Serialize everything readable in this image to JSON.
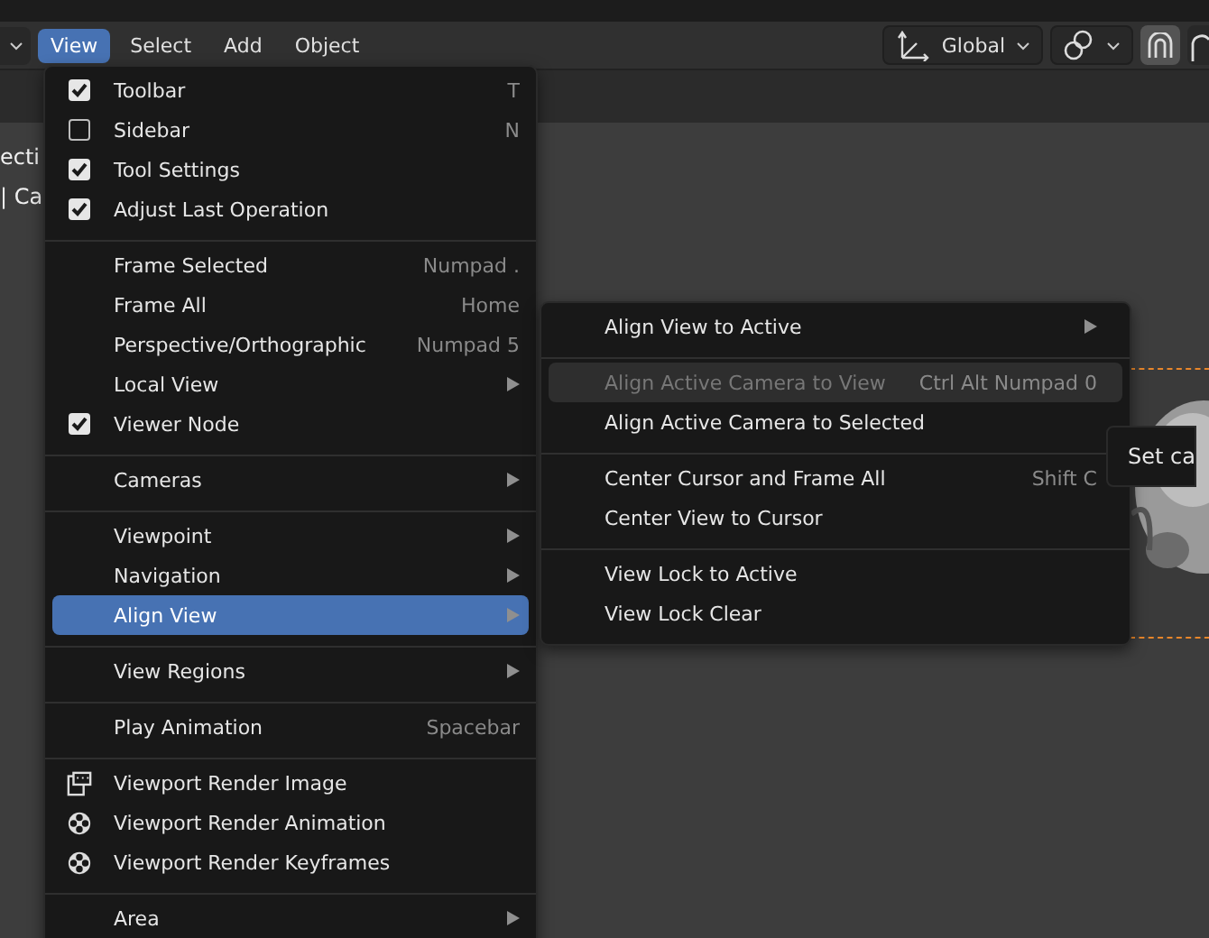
{
  "header": {
    "menus": [
      {
        "label": "View",
        "selected": true
      },
      {
        "label": "Select",
        "selected": false
      },
      {
        "label": "Add",
        "selected": false
      },
      {
        "label": "Object",
        "selected": false
      }
    ],
    "orientation": {
      "label": "Global"
    }
  },
  "viewport": {
    "overlay_texts": [
      "ecti",
      "| Ca"
    ]
  },
  "view_menu": {
    "sections": [
      [
        {
          "kind": "check",
          "label": "Toolbar",
          "shortcut": "T",
          "checked": true,
          "selected": false
        },
        {
          "kind": "check",
          "label": "Sidebar",
          "shortcut": "N",
          "checked": false,
          "selected": false
        },
        {
          "kind": "check",
          "label": "Tool Settings",
          "checked": true,
          "selected": false
        },
        {
          "kind": "check",
          "label": "Adjust Last Operation",
          "checked": true,
          "selected": false
        }
      ],
      [
        {
          "kind": "plain",
          "label": "Frame Selected",
          "shortcut": "Numpad .",
          "selected": false
        },
        {
          "kind": "plain",
          "label": "Frame All",
          "shortcut": "Home",
          "selected": false
        },
        {
          "kind": "plain",
          "label": "Perspective/Orthographic",
          "shortcut": "Numpad 5",
          "selected": false
        },
        {
          "kind": "submenu",
          "label": "Local View",
          "selected": false
        },
        {
          "kind": "check",
          "label": "Viewer Node",
          "checked": true,
          "selected": false
        }
      ],
      [
        {
          "kind": "submenu",
          "label": "Cameras",
          "selected": false
        }
      ],
      [
        {
          "kind": "submenu",
          "label": "Viewpoint",
          "selected": false
        },
        {
          "kind": "submenu",
          "label": "Navigation",
          "selected": false
        },
        {
          "kind": "submenu",
          "label": "Align View",
          "selected": true
        }
      ],
      [
        {
          "kind": "submenu",
          "label": "View Regions",
          "selected": false
        }
      ],
      [
        {
          "kind": "plain",
          "label": "Play Animation",
          "shortcut": "Spacebar",
          "selected": false
        }
      ],
      [
        {
          "kind": "render_still",
          "label": "Viewport Render Image",
          "selected": false
        },
        {
          "kind": "render_reel",
          "label": "Viewport Render Animation",
          "selected": false
        },
        {
          "kind": "render_reel",
          "label": "Viewport Render Keyframes",
          "selected": false
        }
      ],
      [
        {
          "kind": "submenu",
          "label": "Area",
          "selected": false
        }
      ]
    ]
  },
  "align_view_menu": {
    "sections": [
      [
        {
          "kind": "submenu",
          "label": "Align View to Active",
          "disabled": false,
          "selected": false
        }
      ],
      [
        {
          "kind": "plain",
          "label": "Align Active Camera to View",
          "shortcut": "Ctrl Alt Numpad 0",
          "disabled": true,
          "selected": true
        },
        {
          "kind": "plain",
          "label": "Align Active Camera to Selected",
          "disabled": false,
          "selected": false
        }
      ],
      [
        {
          "kind": "plain",
          "label": "Center Cursor and Frame All",
          "shortcut": "Shift C",
          "disabled": false,
          "selected": false
        },
        {
          "kind": "plain",
          "label": "Center View to Cursor",
          "disabled": false,
          "selected": false
        }
      ],
      [
        {
          "kind": "plain",
          "label": "View Lock to Active",
          "disabled": false,
          "selected": false
        },
        {
          "kind": "plain",
          "label": "View Lock Clear",
          "disabled": false,
          "selected": false
        }
      ]
    ]
  },
  "tooltip": {
    "text": "Set ca"
  }
}
